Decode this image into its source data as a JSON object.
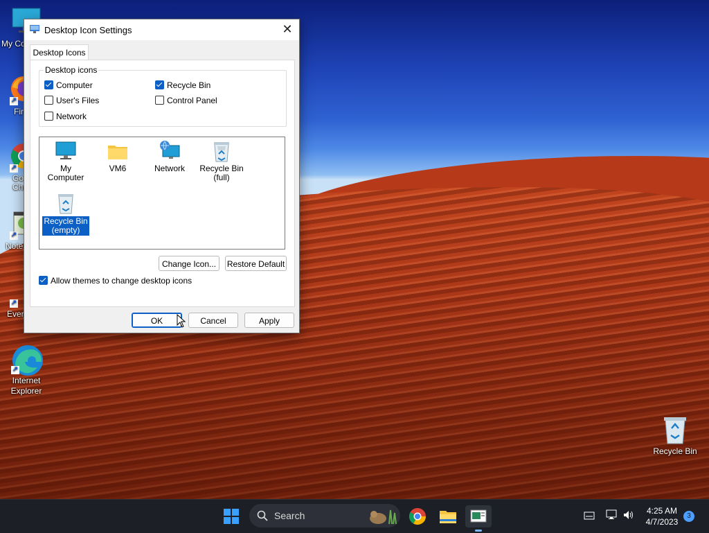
{
  "desktop": {
    "icons": [
      {
        "label": "My Co"
      },
      {
        "label": "Fir"
      },
      {
        "label": "Go\nChr"
      },
      {
        "label": "Note"
      },
      {
        "label": "Ever"
      },
      {
        "label": "Internet\nExplorer"
      },
      {
        "label": "Recycle Bin"
      }
    ]
  },
  "dialog": {
    "title": "Desktop Icon Settings",
    "close_glyph": "✕",
    "tab_label": "Desktop Icons",
    "group_label": "Desktop icons",
    "checkboxes": [
      {
        "label": "Computer",
        "checked": true
      },
      {
        "label": "Recycle Bin",
        "checked": true
      },
      {
        "label": "User's Files",
        "checked": false
      },
      {
        "label": "Control Panel",
        "checked": false
      },
      {
        "label": "Network",
        "checked": false
      }
    ],
    "icon_list": [
      {
        "label": "My Computer",
        "icon": "monitor-icon"
      },
      {
        "label": "VM6",
        "icon": "folder-icon"
      },
      {
        "label": "Network",
        "icon": "network-icon"
      },
      {
        "label": "Recycle Bin\n(full)",
        "icon": "recycle-bin-full-icon"
      },
      {
        "label": "Recycle Bin\n(empty)",
        "icon": "recycle-bin-empty-icon",
        "selected": true
      }
    ],
    "change_icon_label": "Change Icon...",
    "restore_default_label": "Restore Default",
    "allow_themes_label": "Allow themes to change desktop icons",
    "allow_themes_checked": true,
    "ok_label": "OK",
    "cancel_label": "Cancel",
    "apply_label": "Apply"
  },
  "taskbar": {
    "search_placeholder": "Search",
    "time": "4:25 AM",
    "date": "4/7/2023",
    "notification_count": "3"
  },
  "colors": {
    "accent": "#0b5fc5",
    "taskbar": "#1c1f26",
    "dune": "#a63517",
    "sky": "#2f62d2"
  }
}
